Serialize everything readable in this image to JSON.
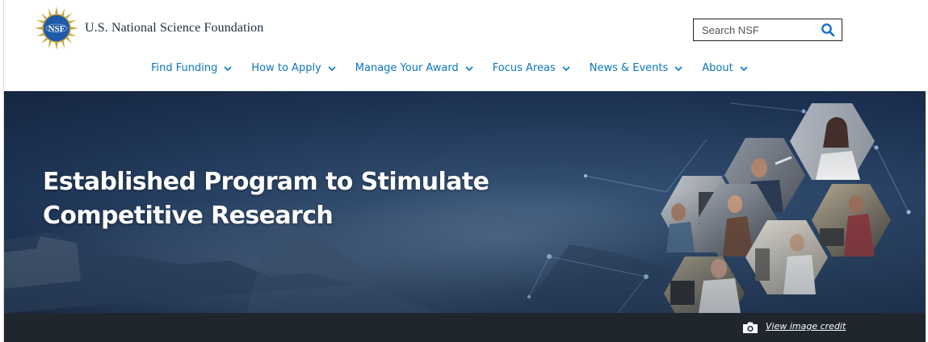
{
  "header": {
    "site_name": "U.S. National Science Foundation",
    "logo_text": "NSF",
    "search": {
      "placeholder": "Search NSF",
      "value": ""
    }
  },
  "nav": {
    "items": [
      {
        "label": "Find Funding"
      },
      {
        "label": "How to Apply"
      },
      {
        "label": "Manage Your Award"
      },
      {
        "label": "Focus Areas"
      },
      {
        "label": "News & Events"
      },
      {
        "label": "About"
      }
    ]
  },
  "hero": {
    "title_line1": "Established Program to Stimulate",
    "title_line2": "Competitive Research",
    "credit_link": "View image credit"
  },
  "colors": {
    "nav_link": "#0b76c4",
    "hero_bg": "#1c3152",
    "credit_bar": "#20262e",
    "logo_blue": "#1e5aa8",
    "logo_gold": "#c9a43a"
  },
  "icons": {
    "search": "search-icon",
    "chevron": "chevron-down-icon",
    "camera": "camera-icon",
    "logo": "nsf-logo"
  }
}
